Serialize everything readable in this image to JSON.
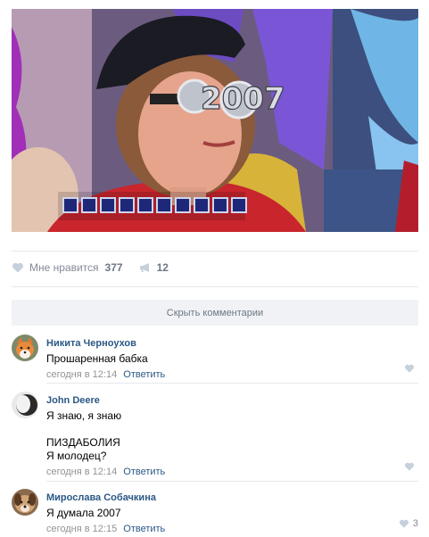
{
  "post": {
    "photo": {
      "glasses_text": "2007",
      "caption_box_count": 10
    },
    "actions": {
      "like_label": "Мне нравится",
      "like_count": "377",
      "share_count": "12"
    },
    "hide_comments_label": "Скрыть комментарии"
  },
  "comments": [
    {
      "author": "Никита Черноухов",
      "lines": [
        "Прошаренная бабка"
      ],
      "time": "сегодня в 12:14",
      "reply": "Ответить",
      "likes": ""
    },
    {
      "author": "John Deere",
      "lines": [
        "Я знаю, я знаю",
        "",
        "ПИЗДАБОЛИЯ",
        "Я молодец?"
      ],
      "time": "сегодня в 12:14",
      "reply": "Ответить",
      "likes": ""
    },
    {
      "author": "Мирослава Собачкина",
      "lines": [
        "Я думала 2007"
      ],
      "time": "сегодня в 12:15",
      "reply": "Ответить",
      "likes": "3"
    }
  ],
  "icons": {
    "like": "heart-icon",
    "share": "megaphone-icon"
  },
  "colors": {
    "link": "#2a5885",
    "muted": "#828a99",
    "divider": "#e7e8ec",
    "button_bg": "#f0f2f5"
  }
}
